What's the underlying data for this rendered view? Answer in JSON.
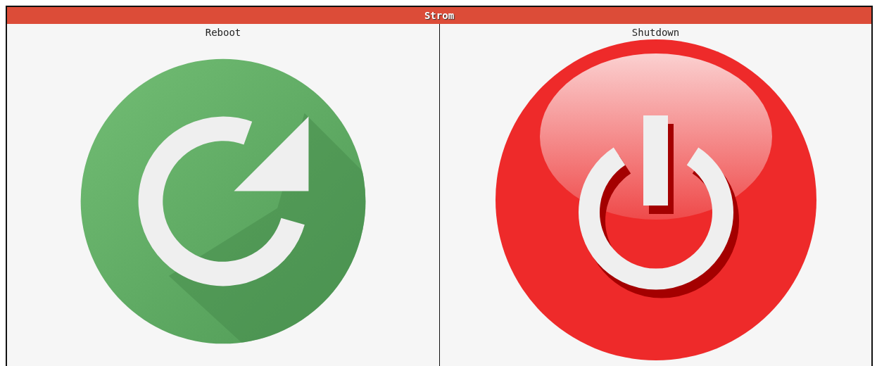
{
  "header": {
    "title": "Strom"
  },
  "actions": [
    {
      "label": "Reboot",
      "kind": "reboot"
    },
    {
      "label": "Shutdown",
      "kind": "shutdown"
    }
  ]
}
